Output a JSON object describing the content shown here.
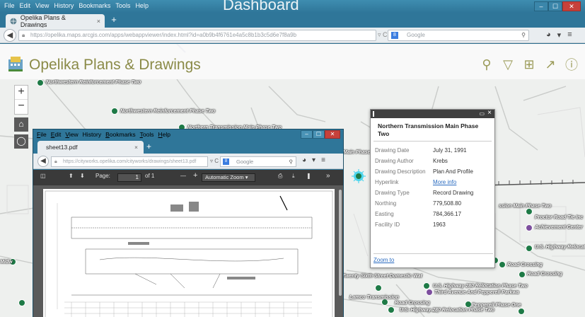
{
  "outer": {
    "menu": [
      "File",
      "Edit",
      "View",
      "History",
      "Bookmarks",
      "Tools",
      "Help"
    ],
    "caption": "Dashboard",
    "tab_title": "Opelika Plans & Drawings",
    "tab_close": "×",
    "new_tab": "+",
    "url": "https://opelika.maps.arcgis.com/apps/webappviewer/index.html?id=a0b9b4f6761e4a5c8b1b3c5d6e7f8a9b",
    "search_placeholder": "Google",
    "win_min": "–",
    "win_max": "☐",
    "win_close": "✕"
  },
  "app": {
    "title": "Opelika Plans & Drawings",
    "tools": [
      "search-icon",
      "filter-icon",
      "grid-icon",
      "share-icon",
      "help-icon"
    ]
  },
  "map_controls": {
    "zoom_in": "+",
    "zoom_out": "−"
  },
  "map_labels": [
    "Northwestern Reinforcement Phase Two",
    "Northwestern Reinforcement Phase Two",
    "Northern Transmission Main Phase Two",
    "Main Phase Two",
    "ssion Main Phase Two",
    "Proctor Road Tie Inc",
    "Achievement Center",
    "U.S. Highway Relocat",
    "Road Crossing",
    "Road Crossing",
    "Twenty Sixth Street Domestic Wat",
    "U.S. Highway 280 Relocation Phase Two",
    "Third Avenue And Pepperell Parkwa",
    "Lamco Transmission",
    "Road Crossing",
    "Pepperell Phase One",
    "U.S. Highway 280 Relocation Phase Two",
    "Midw"
  ],
  "popup": {
    "title": "Northern Transmission Main Phase Two",
    "rows": [
      {
        "label": "Drawing Date",
        "value": "July 31, 1991"
      },
      {
        "label": "Drawing Author",
        "value": "Krebs"
      },
      {
        "label": "Drawing Description",
        "value": "Plan And Profile"
      },
      {
        "label": "Hyperlink",
        "value": "More info"
      },
      {
        "label": "Drawing Type",
        "value": "Record Drawing"
      },
      {
        "label": "Northing",
        "value": "779,508.80"
      },
      {
        "label": "Easting",
        "value": "784,366.17"
      },
      {
        "label": "Facility ID",
        "value": "1963"
      }
    ],
    "zoom_link": "Zoom to"
  },
  "pdf_window": {
    "menu": [
      {
        "u": "F",
        "rest": "ile"
      },
      {
        "u": "E",
        "rest": "dit"
      },
      {
        "u": "V",
        "rest": "iew"
      },
      {
        "u": "",
        "rest": "History"
      },
      {
        "u": "B",
        "rest": "ookmarks"
      },
      {
        "u": "T",
        "rest": "ools"
      },
      {
        "u": "H",
        "rest": "elp"
      }
    ],
    "tab_title": "sheet13.pdf",
    "tab_close": "×",
    "new_tab": "+",
    "url": "https://cityworks.opelika.com/cityworks/drawings/sheet13.pdf",
    "search_placeholder": "Google",
    "toolbar": {
      "page_label": "Page:",
      "page_value": "1",
      "page_total": "of 1",
      "zoom_minus": "—",
      "zoom_plus": "+",
      "zoom_value": "Automatic Zoom",
      "more": "»"
    }
  },
  "colors": {
    "accent": "#8a8a47",
    "marker_green": "#1e7a46",
    "marker_purple": "#7d4f9e",
    "window_blue": "#2f7699"
  }
}
